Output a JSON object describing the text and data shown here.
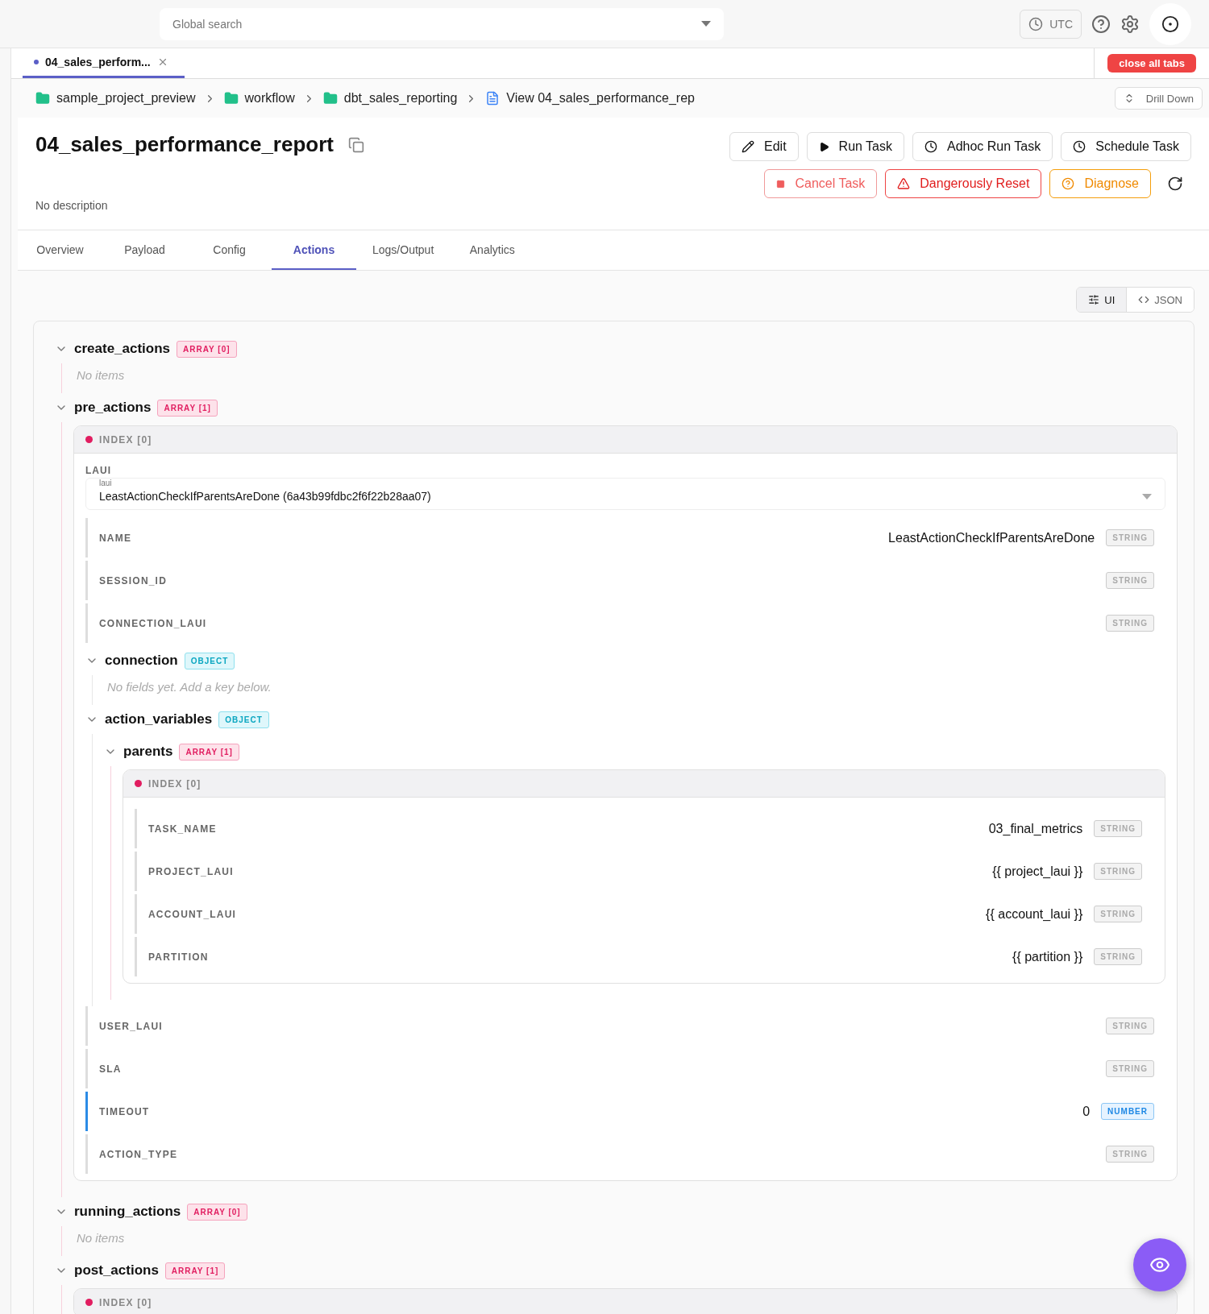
{
  "topbar": {
    "search_placeholder": "Global search",
    "timezone": "UTC"
  },
  "tabs": [
    {
      "label": "04_sales_perform...",
      "selected": true
    }
  ],
  "close_all": "close all tabs",
  "breadcrumbs": [
    {
      "label": "sample_project_preview",
      "kind": "folder"
    },
    {
      "label": "workflow",
      "kind": "folder"
    },
    {
      "label": "dbt_sales_reporting",
      "kind": "folder"
    },
    {
      "label": "View 04_sales_performance_rep",
      "kind": "file"
    }
  ],
  "drill_down": "Drill Down",
  "title": "04_sales_performance_report",
  "description": "No description",
  "actions": [
    [
      {
        "label": "Edit",
        "kind": "edit"
      },
      {
        "label": "Run Task",
        "kind": "run"
      },
      {
        "label": "Adhoc Run Task",
        "kind": "adhoc"
      },
      {
        "label": "Schedule Task",
        "kind": "schedule"
      }
    ],
    [
      {
        "label": "Cancel Task",
        "kind": "cancel"
      },
      {
        "label": "Dangerously Reset",
        "kind": "reset"
      },
      {
        "label": "Diagnose",
        "kind": "diagnose"
      }
    ]
  ],
  "page_tabs": [
    {
      "label": "Overview",
      "selected": false
    },
    {
      "label": "Payload",
      "selected": false
    },
    {
      "label": "Config",
      "selected": false
    },
    {
      "label": "Actions",
      "selected": true
    },
    {
      "label": "Logs/Output",
      "selected": false
    },
    {
      "label": "Analytics",
      "selected": false
    }
  ],
  "view_toggle": [
    {
      "label": "UI",
      "kind": "ui",
      "selected": true
    },
    {
      "label": "JSON",
      "kind": "json",
      "selected": false
    }
  ],
  "tree": [
    {
      "kind": "array",
      "name": "create_actions",
      "type": "ARRAY [0]",
      "expanded": true,
      "empty_text": "No items"
    },
    {
      "kind": "array",
      "name": "pre_actions",
      "type": "ARRAY [1]",
      "expanded": true,
      "items": [
        {
          "index_label": "INDEX [0]",
          "select": {
            "label": "LAUI",
            "floating": "laui",
            "value": "LeastActionCheckIfParentsAreDone (6a43b99fdbc2f6f22b28aa07)"
          },
          "fields": [
            {
              "kind": "string",
              "key": "NAME",
              "value": "LeastActionCheckIfParentsAreDone",
              "type": "STRING",
              "focused": false
            },
            {
              "kind": "string",
              "key": "SESSION_ID",
              "type": "STRING",
              "focused": false
            },
            {
              "kind": "string",
              "key": "CONNECTION_LAUI",
              "type": "STRING",
              "focused": false
            },
            {
              "kind": "object",
              "name": "connection",
              "type": "OBJECT",
              "expanded": true,
              "empty_text": "No fields yet. Add a key below."
            },
            {
              "kind": "object",
              "name": "action_variables",
              "type": "OBJECT",
              "expanded": true,
              "children": [
                {
                  "kind": "array",
                  "name": "parents",
                  "type": "ARRAY [1]",
                  "expanded": true,
                  "items": [
                    {
                      "index_label": "INDEX [0]",
                      "fields": [
                        {
                          "kind": "string",
                          "key": "TASK_NAME",
                          "value": "03_final_metrics",
                          "type": "STRING",
                          "focused": false
                        },
                        {
                          "kind": "string",
                          "key": "PROJECT_LAUI",
                          "value": "{{ project_laui }}",
                          "type": "STRING",
                          "focused": false
                        },
                        {
                          "kind": "string",
                          "key": "ACCOUNT_LAUI",
                          "value": "{{ account_laui }}",
                          "type": "STRING",
                          "focused": false
                        },
                        {
                          "kind": "string",
                          "key": "PARTITION",
                          "value": "{{ partition }}",
                          "type": "STRING",
                          "focused": false
                        }
                      ]
                    }
                  ]
                }
              ]
            },
            {
              "kind": "string",
              "key": "USER_LAUI",
              "type": "STRING",
              "focused": false
            },
            {
              "kind": "string",
              "key": "SLA",
              "type": "STRING",
              "focused": false
            },
            {
              "kind": "number",
              "key": "TIMEOUT",
              "value": "0",
              "type": "NUMBER",
              "focused": true
            },
            {
              "kind": "string",
              "key": "ACTION_TYPE",
              "type": "STRING",
              "focused": false
            }
          ]
        }
      ]
    },
    {
      "kind": "array",
      "name": "running_actions",
      "type": "ARRAY [0]",
      "expanded": true,
      "empty_text": "No items"
    },
    {
      "kind": "array",
      "name": "post_actions",
      "type": "ARRAY [1]",
      "expanded": true,
      "items": [
        {
          "index_label": "INDEX [0]"
        }
      ]
    }
  ]
}
